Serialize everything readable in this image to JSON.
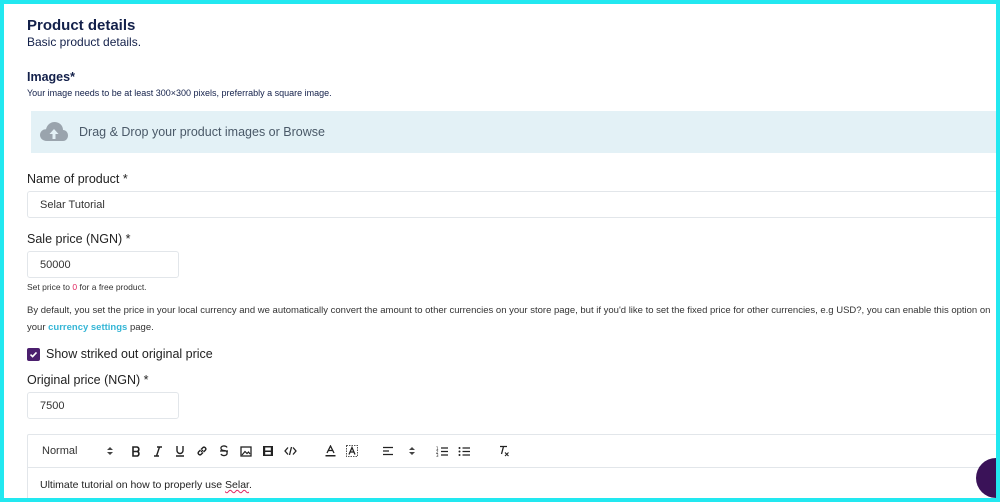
{
  "section": {
    "title": "Product details",
    "subtitle": "Basic product details."
  },
  "images": {
    "label": "Images*",
    "hint": "Your image needs to be at least 300×300 pixels, preferrably a square image.",
    "dropzone_text": "Drag & Drop your product images or Browse",
    "icon": "cloud-upload-icon"
  },
  "name_field": {
    "label": "Name of product *",
    "value": "Selar Tutorial"
  },
  "sale_price": {
    "label": "Sale price (NGN) *",
    "value": "50000",
    "hint_before": "Set price to ",
    "hint_zero": "0",
    "hint_after": " for a free product."
  },
  "currency_note": {
    "text_before": "By default, you set the price in your local currency and we automatically convert the amount to other currencies on your store page, but if you'd like to set the fixed price for other currencies, e.g USD?, you can enable this option on your ",
    "link": "currency settings",
    "text_after": " page."
  },
  "strike_option": {
    "label": "Show striked out original price",
    "checked": true
  },
  "original_price": {
    "label": "Original price (NGN) *",
    "value": "7500"
  },
  "editor": {
    "format_select": "Normal",
    "text_before": "Ultimate tutorial on how to properly use ",
    "misspelled": "Selar",
    "text_after": "."
  },
  "colors": {
    "accent_purple": "#4b1f6e",
    "link_cyan": "#35b6d6",
    "frame_cyan": "#22e8f0",
    "dropzone_bg": "#e3f1f6",
    "title_navy": "#13204a"
  }
}
